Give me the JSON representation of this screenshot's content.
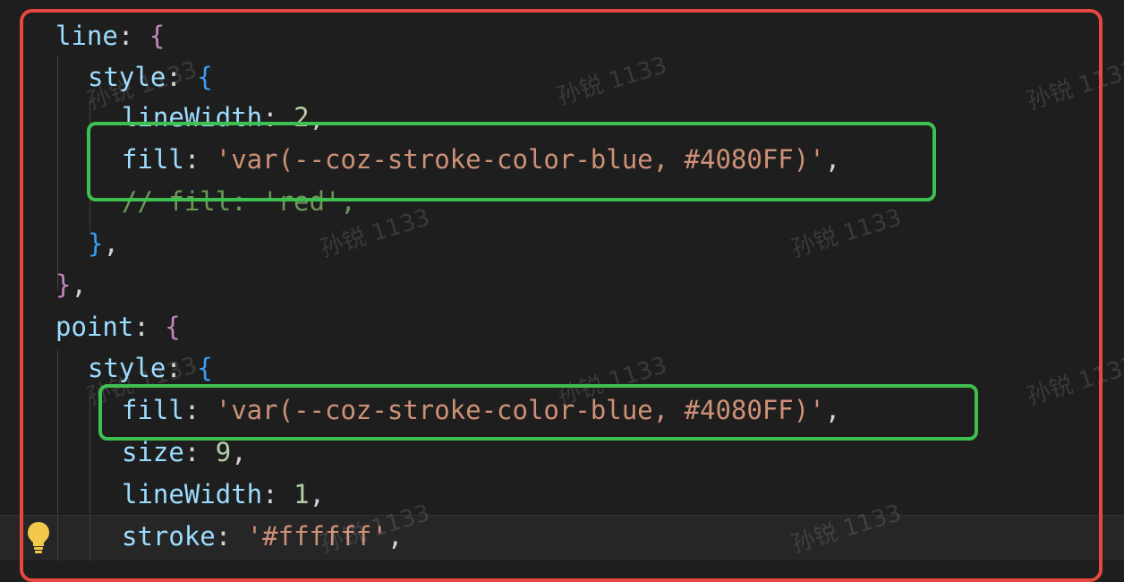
{
  "code_lines": [
    {
      "id": "line-key",
      "tokens": [
        {
          "t": "line",
          "c": "key"
        },
        {
          "t": ": ",
          "c": "punc"
        },
        {
          "t": "{",
          "c": "b1"
        }
      ]
    },
    {
      "id": "style-key",
      "tokens": [
        {
          "t": "style",
          "c": "key"
        },
        {
          "t": ": ",
          "c": "punc"
        },
        {
          "t": "{",
          "c": "b2"
        }
      ]
    },
    {
      "id": "linewidth",
      "tokens": [
        {
          "t": "lineWidth",
          "c": "key"
        },
        {
          "t": ": ",
          "c": "punc"
        },
        {
          "t": "2",
          "c": "num"
        },
        {
          "t": ",",
          "c": "punc"
        }
      ]
    },
    {
      "id": "fill-line",
      "tokens": [
        {
          "t": "fill",
          "c": "key"
        },
        {
          "t": ": ",
          "c": "punc"
        },
        {
          "t": "'var(--coz-stroke-color-blue, #4080FF)'",
          "c": "str"
        },
        {
          "t": ",",
          "c": "punc"
        }
      ]
    },
    {
      "id": "comment",
      "tokens": [
        {
          "t": "// fill: 'red',",
          "c": "cmt"
        }
      ]
    },
    {
      "id": "close-style",
      "tokens": [
        {
          "t": "}",
          "c": "b2"
        },
        {
          "t": ",",
          "c": "punc"
        }
      ]
    },
    {
      "id": "close-line",
      "tokens": [
        {
          "t": "}",
          "c": "b1"
        },
        {
          "t": ",",
          "c": "punc"
        }
      ]
    },
    {
      "id": "point-key",
      "tokens": [
        {
          "t": "point",
          "c": "key"
        },
        {
          "t": ": ",
          "c": "punc"
        },
        {
          "t": "{",
          "c": "b1"
        }
      ]
    },
    {
      "id": "style-key-2",
      "tokens": [
        {
          "t": "style",
          "c": "key"
        },
        {
          "t": ": ",
          "c": "punc"
        },
        {
          "t": "{",
          "c": "b2"
        }
      ]
    },
    {
      "id": "fill-point",
      "tokens": [
        {
          "t": "fill",
          "c": "key"
        },
        {
          "t": ": ",
          "c": "punc"
        },
        {
          "t": "'var(--coz-stroke-color-blue, #4080FF)'",
          "c": "str"
        },
        {
          "t": ",",
          "c": "punc"
        }
      ]
    },
    {
      "id": "size",
      "tokens": [
        {
          "t": "size",
          "c": "key"
        },
        {
          "t": ": ",
          "c": "punc"
        },
        {
          "t": "9",
          "c": "num"
        },
        {
          "t": ",",
          "c": "punc"
        }
      ]
    },
    {
      "id": "linewidth-2",
      "tokens": [
        {
          "t": "lineWidth",
          "c": "key"
        },
        {
          "t": ": ",
          "c": "punc"
        },
        {
          "t": "1",
          "c": "num"
        },
        {
          "t": ",",
          "c": "punc"
        }
      ]
    },
    {
      "id": "stroke",
      "tokens": [
        {
          "t": "stroke",
          "c": "key"
        },
        {
          "t": ": ",
          "c": "punc"
        },
        {
          "t": "'#ffffff'",
          "c": "str"
        },
        {
          "t": ",",
          "c": "punc"
        }
      ]
    }
  ],
  "watermark_text": "孙锐 1133",
  "colors": {
    "background": "#1e1e1e",
    "highlight_red": "#e5483e",
    "highlight_green": "#3ec050"
  },
  "gutter_icon": "lightbulb-icon"
}
